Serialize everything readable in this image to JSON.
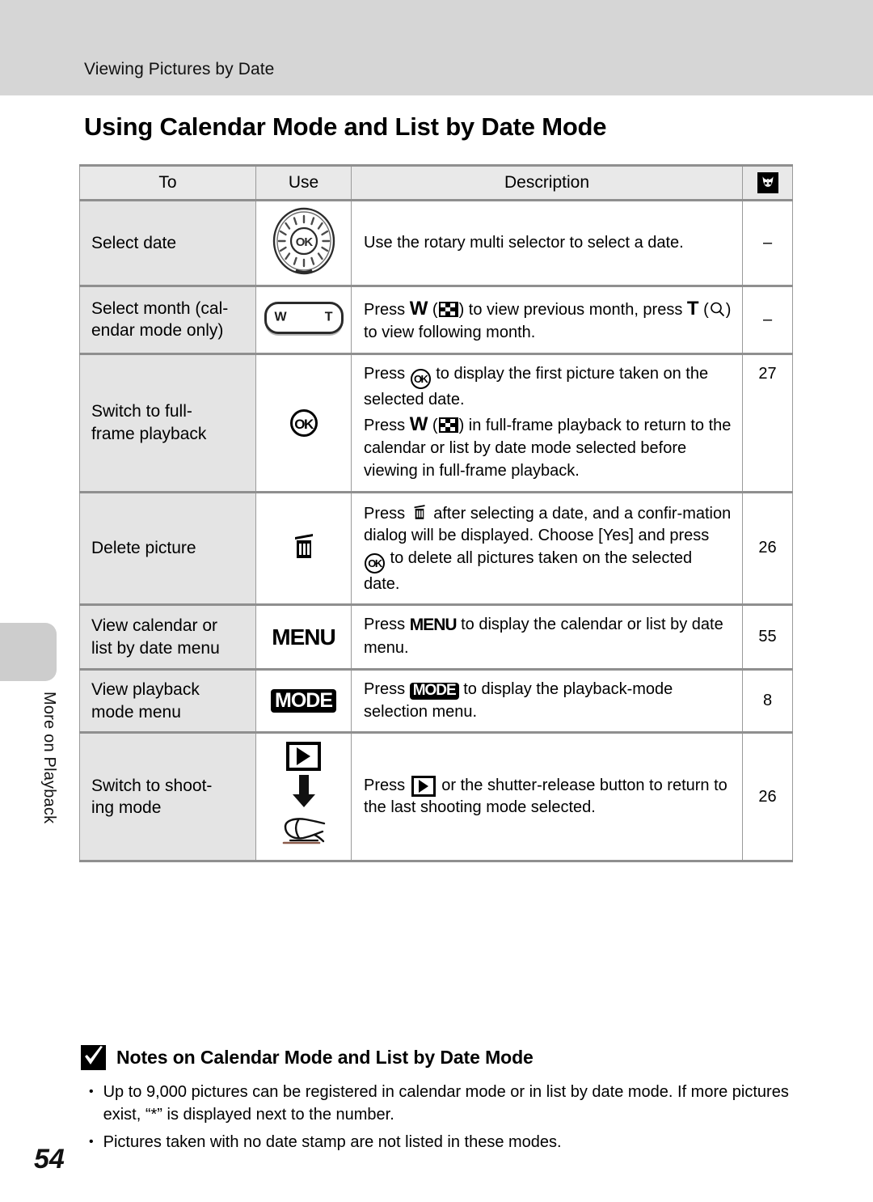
{
  "header": {
    "running_head": "Viewing Pictures by Date"
  },
  "page_title": "Using Calendar Mode and List by Date Mode",
  "side_tab": {
    "label": "More on Playback"
  },
  "page_number": "54",
  "table": {
    "headers": {
      "to": "To",
      "use": "Use",
      "description": "Description",
      "reference": "book-reference-icon"
    },
    "rows": [
      {
        "to": "Select date",
        "use_icon": "rotary-multi-selector-dial",
        "description_lines": [
          "Use the rotary multi selector to select a date."
        ],
        "reference": "–"
      },
      {
        "to": "Select month (cal-endar mode only)",
        "to_line1": "Select month (cal-",
        "to_line2": "endar mode only)",
        "use_icon": "zoom-w-t-button",
        "use_labels": {
          "w": "W",
          "t": "T"
        },
        "description_parts": {
          "p1": "Press ",
          "w": "W",
          "p2": " (",
          "thumb_icon": "thumbnail-grid-icon",
          "p3": ") to view previous month, press ",
          "t": "T",
          "p4": " (",
          "mag_icon": "magnifier-icon",
          "p5": ") to view following month."
        },
        "reference": "–"
      },
      {
        "to_line1": "Switch to full-",
        "to_line2": "frame playback",
        "use_icon": "ok-button-icon",
        "description_parts": {
          "p1": "Press ",
          "ok1": "ok-button-icon",
          "p2": " to display the first picture taken on the selected date.",
          "p3": "Press ",
          "w": "W",
          "p4": " (",
          "thumb_icon": "thumbnail-grid-icon",
          "p5": ") in full-frame playback to return to the calendar or list by date mode selected before viewing in full-frame playback."
        },
        "reference": "27"
      },
      {
        "to": "Delete picture",
        "use_icon": "trash-can-icon",
        "description_parts": {
          "p1": "Press ",
          "trash": "trash-can-icon",
          "p2": " after selecting a date, and a confir-mation dialog will be displayed. Choose [Yes] and press ",
          "ok": "ok-button-icon",
          "p3": " to delete all pictures taken on the selected date."
        },
        "reference": "26"
      },
      {
        "to_line1": "View calendar or",
        "to_line2": "list by date menu",
        "use_icon": "menu-button-icon",
        "use_label": "MENU",
        "description_parts": {
          "p1": "Press ",
          "menu": "MENU",
          "p2": " to display the calendar or list by date menu."
        },
        "reference": "55"
      },
      {
        "to_line1": "View playback",
        "to_line2": "mode menu",
        "use_icon": "mode-button-icon",
        "use_label": "MODE",
        "description_parts": {
          "p1": "Press ",
          "mode": "MODE",
          "p2": " to display the playback-mode selection menu."
        },
        "reference": "8"
      },
      {
        "to_line1": "Switch to shoot-",
        "to_line2": "ing mode",
        "use_icon": "playback-to-shooting-mode-icon",
        "description_parts": {
          "p1": "Press ",
          "play": "playback-button-icon",
          "p2": " or the shutter-release button to return to the last shooting mode selected."
        },
        "reference": "26"
      }
    ]
  },
  "notes": {
    "icon": "check-mark-icon",
    "title": "Notes on Calendar Mode and List by Date Mode",
    "bullet": "•",
    "items": [
      "Up to 9,000 pictures can be registered in calendar mode or in list by date mode. If more pictures exist, “*” is displayed next to the number.",
      "Pictures taken with no date stamp are not listed in these modes."
    ]
  },
  "colors": {
    "header_band": "#d6d6d6",
    "table_header_bg": "#e9e9e9",
    "row_label_bg": "#e4e4e4",
    "rule": "#8f8f8f"
  }
}
